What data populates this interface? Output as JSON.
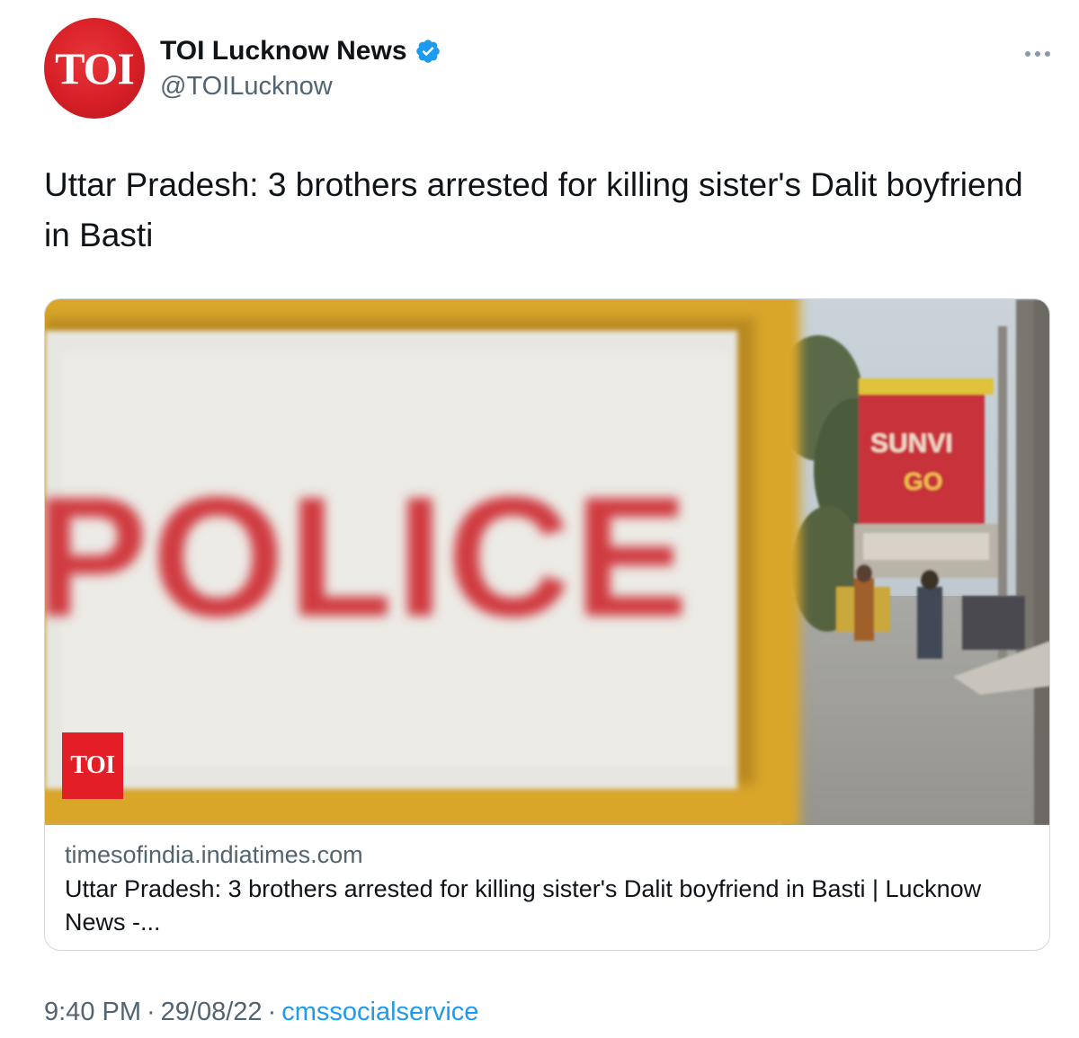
{
  "author": {
    "avatar_text": "TOI",
    "display_name": "TOI Lucknow News",
    "handle": "@TOILucknow",
    "verified": true
  },
  "tweet": {
    "text": "Uttar Pradesh: 3 brothers arrested for killing sister's Dalit boyfriend in Basti"
  },
  "card": {
    "image_sign_text": "POLICE",
    "image_billboard_text": "SUNVI GO",
    "badge_text": "TOI",
    "domain": "timesofindia.indiatimes.com",
    "title": "Uttar Pradesh: 3 brothers arrested for killing sister's Dalit boyfriend in Basti | Lucknow News -..."
  },
  "footer": {
    "time": "9:40 PM",
    "separator": "·",
    "date": "29/08/22",
    "source": "cmssocialservice"
  },
  "icons": {
    "more": "more-horizontal-icon",
    "verified": "verified-badge-icon"
  },
  "colors": {
    "brand_red": "#d71f26",
    "verified_blue": "#1d9bf0",
    "link_blue": "#1d9bf0",
    "secondary_text": "#536471"
  }
}
